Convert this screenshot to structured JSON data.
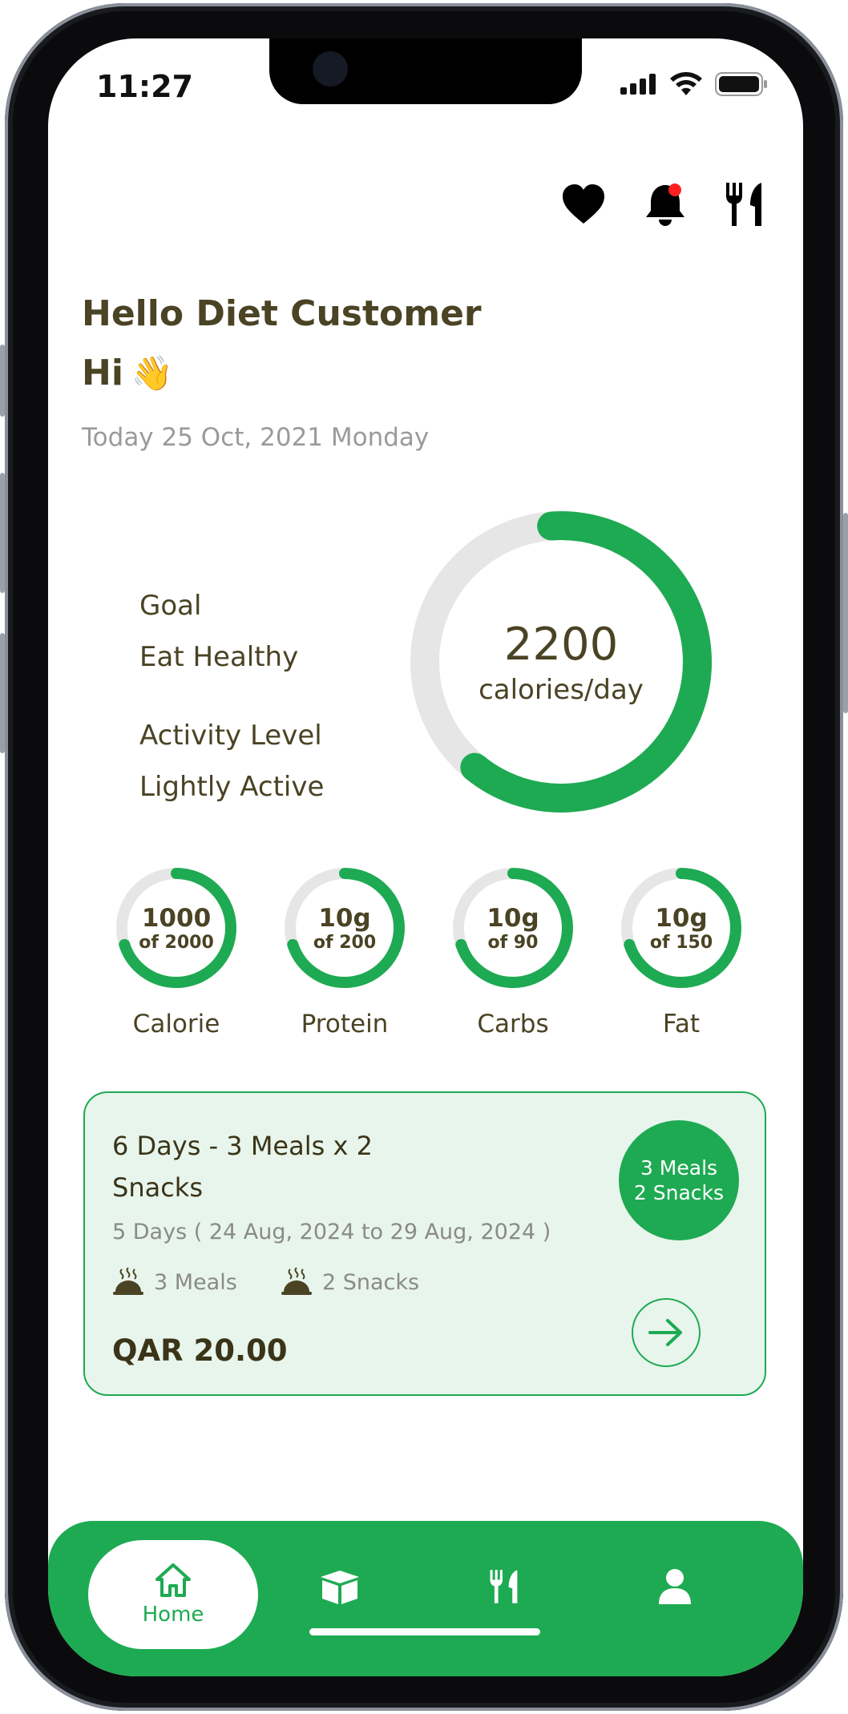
{
  "status_bar": {
    "time": "11:27"
  },
  "header_icons": [
    "heart-icon",
    "bell-icon",
    "cutlery-icon"
  ],
  "greeting": {
    "title": "Hello Diet Customer",
    "hi": "Hi",
    "emoji": "👋"
  },
  "date": "Today 25 Oct, 2021 Monday",
  "goal": {
    "goal_label": "Goal",
    "goal_value": "Eat Healthy",
    "activity_label": "Activity Level",
    "activity_value": "Lightly Active"
  },
  "calorie_ring": {
    "value": "2200",
    "unit": "calories/day",
    "progress": 0.62
  },
  "macros": [
    {
      "value": "1000",
      "of": "of 2000",
      "label": "Calorie",
      "progress": 0.7
    },
    {
      "value": "10g",
      "of": "of 200",
      "label": "Protein",
      "progress": 0.7
    },
    {
      "value": "10g",
      "of": "of 90",
      "label": "Carbs",
      "progress": 0.7
    },
    {
      "value": "10g",
      "of": "of 150",
      "label": "Fat",
      "progress": 0.7
    }
  ],
  "plan": {
    "title": "6 Days - 3 Meals x 2 Snacks",
    "dates": "5 Days ( 24 Aug, 2024 to 29 Aug, 2024 )",
    "meals": "3 Meals",
    "snacks": "2 Snacks",
    "price": "QAR 20.00",
    "badge_line1": "3 Meals",
    "badge_line2": "2 Snacks"
  },
  "bottom_nav": {
    "home": "Home"
  },
  "colors": {
    "accent": "#1eaa52",
    "text_dark": "#4a4324",
    "muted": "#9a9a9a",
    "card_bg": "#e8f5ec",
    "track": "#e6e6e6"
  }
}
